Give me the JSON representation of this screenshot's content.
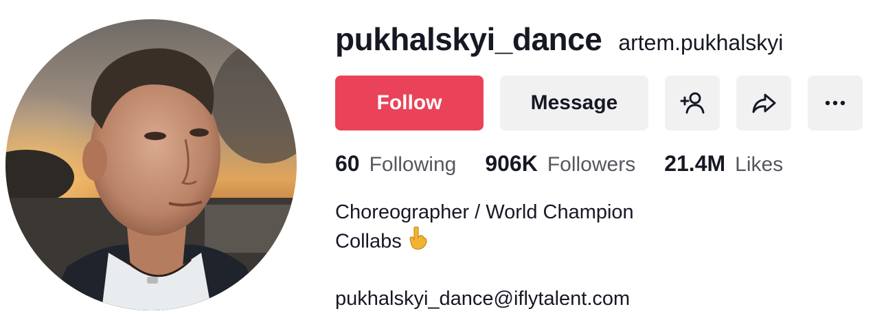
{
  "profile": {
    "username": "pukhalskyi_dance",
    "nickname": "artem.pukhalskyi",
    "avatar_icon": "profile-photo"
  },
  "actions": {
    "follow_label": "Follow",
    "message_label": "Message",
    "add_friend_icon": "add-friend-icon",
    "share_icon": "share-icon",
    "more_icon": "more-icon"
  },
  "stats": [
    {
      "value": "60",
      "label": "Following"
    },
    {
      "value": "906K",
      "label": "Followers"
    },
    {
      "value": "21.4M",
      "label": "Likes"
    }
  ],
  "bio": {
    "line1": "Choreographer / World Champion",
    "line2": "Collabs",
    "line2_emoji": "pointing-down-emoji",
    "email": "pukhalskyi_dance@iflytalent.com"
  },
  "colors": {
    "follow_bg": "#ea4359",
    "button_bg": "#f1f1f2",
    "text_primary": "#161823",
    "text_secondary": "#56575e"
  }
}
